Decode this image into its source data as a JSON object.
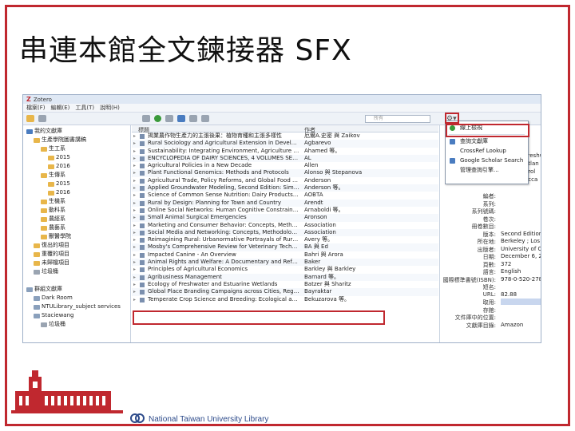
{
  "slide": {
    "title": "串連本館全文鍊接器 SFX"
  },
  "app": {
    "window_title": "Zotero",
    "menu": [
      "檔案(F)",
      "編輯(E)",
      "工具(T)",
      "說明(H)"
    ],
    "search_placeholder": "所有",
    "columns": {
      "title": "標題",
      "author": "作者"
    }
  },
  "library": [
    {
      "label": "我的文獻庫",
      "indent": 0,
      "kind": "lib"
    },
    {
      "label": "生產學院圖書講稿",
      "indent": 1,
      "kind": "folder"
    },
    {
      "label": "生工系",
      "indent": 2,
      "kind": "folder"
    },
    {
      "label": "2015",
      "indent": 3,
      "kind": "folder"
    },
    {
      "label": "2016",
      "indent": 3,
      "kind": "folder"
    },
    {
      "label": "生傳系",
      "indent": 2,
      "kind": "folder"
    },
    {
      "label": "2015",
      "indent": 3,
      "kind": "folder"
    },
    {
      "label": "2016",
      "indent": 3,
      "kind": "folder"
    },
    {
      "label": "生機系",
      "indent": 2,
      "kind": "folder"
    },
    {
      "label": "動科系",
      "indent": 2,
      "kind": "folder"
    },
    {
      "label": "農經系",
      "indent": 2,
      "kind": "folder"
    },
    {
      "label": "農藝系",
      "indent": 2,
      "kind": "folder"
    },
    {
      "label": "獸醫學院",
      "indent": 2,
      "kind": "folder"
    },
    {
      "label": "復出的項目",
      "indent": 1,
      "kind": "folder"
    },
    {
      "label": "重覆的項目",
      "indent": 1,
      "kind": "folder"
    },
    {
      "label": "未歸檔項目",
      "indent": 1,
      "kind": "folder"
    },
    {
      "label": "垃圾桶",
      "indent": 1,
      "kind": "trash"
    },
    {
      "label": "",
      "indent": 0,
      "kind": "spacer"
    },
    {
      "label": "群組文獻庫",
      "indent": 0,
      "kind": "grp"
    },
    {
      "label": "Dark Room",
      "indent": 1,
      "kind": "grp"
    },
    {
      "label": "NTULibrary_subject services",
      "indent": 1,
      "kind": "grp"
    },
    {
      "label": "Staciewang",
      "indent": 1,
      "kind": "grp"
    },
    {
      "label": "垃圾桶",
      "indent": 2,
      "kind": "trash"
    }
  ],
  "items": [
    {
      "title": "揭業農作物生產力的主張後果：植物育種和主張多樣性",
      "author": "厄爾A.史密 與 Zaikov"
    },
    {
      "title": "Rural Sociology and Agricultural Extension in Developing C...",
      "author": "Agbarevo"
    },
    {
      "title": "Sustainability: Integrating Environment, Agriculture and Re...",
      "author": "Ahamed 等。"
    },
    {
      "title": "ENCYCLOPEDIA OF DAIRY SCIENCES, 4 VOLUMES SET, 2N...",
      "author": "AL"
    },
    {
      "title": "Agricultural Policies in a New Decade",
      "author": "Allen"
    },
    {
      "title": "Plant Functional Genomics: Methods and Protocols",
      "author": "Alonso 與 Stepanova"
    },
    {
      "title": "Agricultural Trade, Policy Reforms, and Global Food Security",
      "author": "Anderson"
    },
    {
      "title": "Applied Groundwater Modeling, Second Edition: Simulati...",
      "author": "Anderson 等。"
    },
    {
      "title": "Science of Common Sense Nutrition: Dairy Products Health...",
      "author": "AOBTA"
    },
    {
      "title": "Rural by Design: Planning for Town and Country",
      "author": "Arendt"
    },
    {
      "title": "Online Social Networks: Human Cognitive Constraints in Fa...",
      "author": "Arnaboldi 等。"
    },
    {
      "title": "Small Animal Surgical Emergencies",
      "author": "Aronson"
    },
    {
      "title": "Marketing and Consumer Behavior: Concepts, Methodolo...",
      "author": "Association"
    },
    {
      "title": "Social Media and Networking: Concepts, Methodologies, ...",
      "author": "Association"
    },
    {
      "title": "Reimagining Rural: Urbanormative Portrayals of Rural Life",
      "author": "Avery 等。"
    },
    {
      "title": "Mosby's Comprehensive Review for Veterinary Technicians,...",
      "author": "BA 與 Ed"
    },
    {
      "title": "Impacted Canine - An Overview",
      "author": "Bahri 與 Arora"
    },
    {
      "title": "Animal Rights and Welfare: A Documentary and Reference ...",
      "author": "Baker"
    },
    {
      "title": "Principles of Agricultural Economics",
      "author": "Barkley 與 Barkley"
    },
    {
      "title": "Agribusiness Management",
      "author": "Barnard 等。"
    },
    {
      "title": "Ecology of Freshwater and Estuarine Wetlands",
      "author": "Batzer 與 Sharitz"
    },
    {
      "title": "Global Place Branding Campaigns across Cities, Regions, a...",
      "author": "Bayraktar"
    },
    {
      "title": "Temperate Crop Science and Breeding: Ecological and Ge...",
      "author": "Bekuzarova 等。"
    }
  ],
  "info_pane": {
    "labels": [
      "編者:",
      "系列:",
      "系列號碼:",
      "卷次:",
      "冊卷數目:",
      "版本:",
      "所在地:",
      "出版者:",
      "日期:",
      "頁數:",
      "語言:",
      "國際標準書號(ISBN):",
      "短名:",
      "URL:",
      "取用:",
      "存館:",
      "文件庫中的位置:",
      "文獻庫目錄:"
    ],
    "values": [
      "",
      "",
      "",
      "",
      "",
      "Second Edition e",
      "Berkeley ; Los An",
      "University of Calif",
      "December 6, 201",
      "372",
      "English",
      "978-0-520-27858",
      "",
      "82.88",
      "",
      "",
      "",
      "Amazon"
    ],
    "cropped_top": [
      "Freshw",
      "etlan",
      "arol",
      "ecca"
    ]
  },
  "dropdown": {
    "items": [
      "線上檢視",
      "查詢文獻庫",
      "CrossRef Lookup",
      "Google Scholar Search",
      "管理查詢引擎..."
    ]
  },
  "footer": {
    "text": "National Taiwan University Library"
  },
  "colors": {
    "accent": "#c0282f",
    "nav_blue": "#2c4a8a"
  }
}
